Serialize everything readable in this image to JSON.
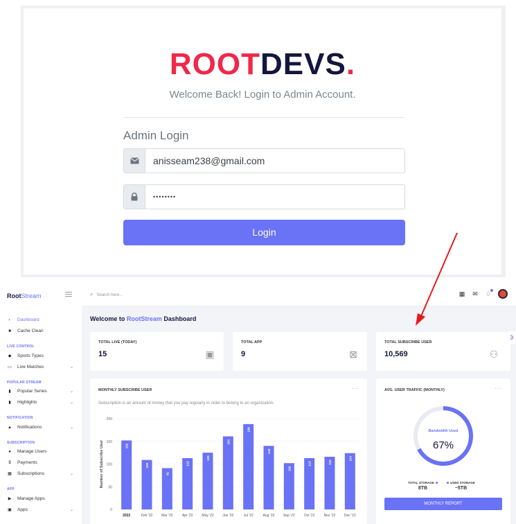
{
  "login": {
    "brand_root": "ROOT",
    "brand_devs": "DEVS",
    "brand_dot": ".",
    "welcome": "Welcome Back! Login to Admin Account.",
    "heading": "Admin Login",
    "email_icon": "envelope-icon",
    "email_value": "anisseam238@gmail.com",
    "password_icon": "lock-icon",
    "password_value": "••••••••",
    "login_label": "Login"
  },
  "colors": {
    "brand_red": "#f0284a",
    "brand_navy": "#15163d",
    "accent": "#6a72f5",
    "arrow": "#e8191a"
  },
  "sidebar": {
    "logo_bold": "Root",
    "logo_light": "Stream",
    "sections": {
      "live_control": "LIVE CONTROL",
      "popular_stream": "POPULAR STREAM",
      "notification": "NOTIFICATION",
      "subscription": "SUBSCRIPTION",
      "app": "APP"
    },
    "items": [
      {
        "label": "Dashboard",
        "icon": "gauge-icon"
      },
      {
        "label": "Cache Clean",
        "icon": "trash-icon"
      },
      {
        "label": "Sports Types",
        "icon": "layers-icon"
      },
      {
        "label": "Live Matches",
        "icon": "monitor-icon"
      },
      {
        "label": "Popular Series",
        "icon": "file-icon"
      },
      {
        "label": "Highlights",
        "icon": "file-icon"
      },
      {
        "label": "Notifications",
        "icon": "bell-icon"
      },
      {
        "label": "Manage Users",
        "icon": "users-icon"
      },
      {
        "label": "Payments",
        "icon": "dollar-icon"
      },
      {
        "label": "Subscriptions",
        "icon": "grid-icon"
      },
      {
        "label": "Manage Apps",
        "icon": "play-icon"
      },
      {
        "label": "Apps",
        "icon": "apps-icon"
      }
    ]
  },
  "topbar": {
    "search_placeholder": "Search here..."
  },
  "dashboard": {
    "title_prefix": "Welcome to ",
    "title_brand": "RootStream",
    "title_suffix": " Dashboard",
    "stats": [
      {
        "label": "TOTAL LIVE (TODAY)",
        "value": "15",
        "icon": "video-file-icon"
      },
      {
        "label": "TOTAL APP",
        "value": "9",
        "icon": "app-store-icon"
      },
      {
        "label": "TOTAL SUBSCRIBE USER",
        "value": "10,569",
        "icon": "users-icon"
      }
    ],
    "monthly": {
      "title": "MONTHLY SUBSCRIBE USER",
      "subtitle": "Subscription is an amount of money that you pay regularly in order to belong to an organization.",
      "dots": "···"
    },
    "traffic": {
      "title": "AVG. USER TRAFFIC (MONTHLY)",
      "dots": "···",
      "gauge_label": "Bandwidth Used",
      "gauge_value": "67%",
      "gauge_fraction": 0.67,
      "total_storage_label": "TOTAL STORAGE",
      "total_storage_value": "8TB",
      "used_storage_label": "USED STORAGE",
      "used_storage_value": "~5TB",
      "report_label": "MONTHLY REPORT"
    }
  },
  "chart_data": {
    "type": "bar",
    "ylabel": "Number of Subscribe User",
    "ylim": [
      0,
      200
    ],
    "yticks": [
      0,
      50,
      100,
      150,
      200
    ],
    "categories": [
      "2022",
      "Feb '22",
      "Mar '22",
      "Apr '22",
      "May '22",
      "Jun '22",
      "Jul '22",
      "Aug '22",
      "Sep '22",
      "Oct '22",
      "Nov '22",
      "Dec '22"
    ],
    "values": [
      152,
      109,
      91,
      113,
      125,
      161,
      188,
      140,
      102,
      113,
      116,
      124
    ],
    "grid": true
  }
}
